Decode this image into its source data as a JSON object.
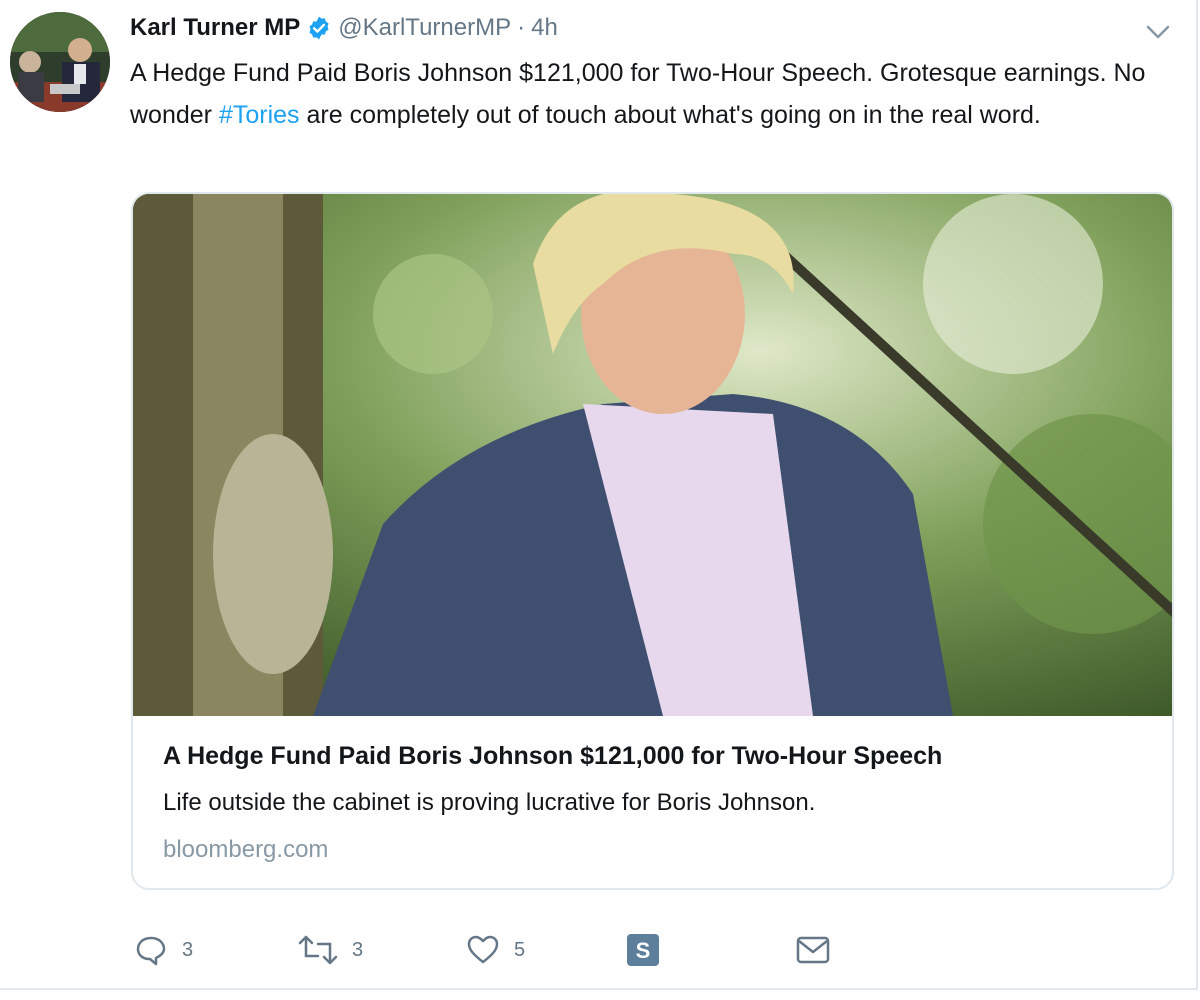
{
  "tweet": {
    "display_name": "Karl Turner MP",
    "handle": "@KarlTurnerMP",
    "separator": "·",
    "time": "4h",
    "text_part1": "A Hedge Fund Paid Boris Johnson $121,000 for Two-Hour Speech. Grotesque earnings. No wonder ",
    "hashtag": "#Tories",
    "text_part2": " are completely out of touch about what's going on in the real word."
  },
  "card": {
    "title": "A Hedge Fund Paid Boris Johnson $121,000 for Two-Hour Speech",
    "description": "Life outside the cabinet is proving lucrative for Boris Johnson.",
    "domain": "bloomberg.com"
  },
  "actions": {
    "reply_count": "3",
    "retweet_count": "3",
    "like_count": "5"
  },
  "colors": {
    "link": "#1da1f2",
    "muted": "#657786",
    "border": "#e1e8ed",
    "verified": "#1da1f2"
  },
  "icons": [
    "verified-icon",
    "chevron-down-icon",
    "reply-icon",
    "retweet-icon",
    "like-icon",
    "s-app-icon",
    "message-icon"
  ]
}
